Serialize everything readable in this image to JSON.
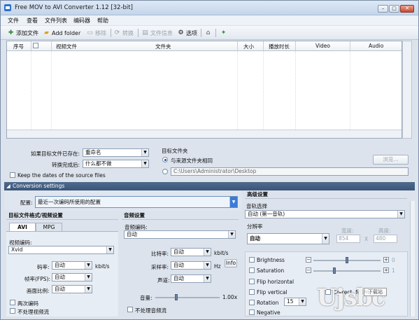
{
  "window": {
    "title": "Free MOV to AVI Converter 1.12  [32-bit]",
    "min": "–",
    "max": "□",
    "close": "✕"
  },
  "menu": [
    "文件",
    "查看",
    "文件列表",
    "编码器",
    "帮助"
  ],
  "toolbar": {
    "add_file": "添加文件",
    "add_folder": "Add folder",
    "remove": "移除",
    "convert": "转换",
    "file_info": "文件信息",
    "options": "选项"
  },
  "grid": {
    "headers": [
      "序号",
      "",
      "视频文件",
      "文件夹",
      "大小",
      "播放时长",
      "Video",
      "Audio"
    ]
  },
  "output": {
    "if_exists_label": "如果目标文件已存在:",
    "if_exists_value": "重命名",
    "after_label": "转换完成后:",
    "after_value": "什么都不做",
    "keep_dates": "Keep the dates of the source files",
    "target_folder_label": "目标文件夹",
    "same_as_source": "与来源文件夹相同",
    "path": "C:\\Users\\Administrator\\Desktop",
    "browse": "浏览..."
  },
  "settings": {
    "header": "Conversion settings",
    "profile_label": "配置:",
    "profile_value": "最近一次编码所使用的配置",
    "format_section": "目标文件格式/视频设置",
    "tabs": [
      "AVI",
      "MPG"
    ],
    "video_codec_label": "视频编码:",
    "video_codec": "Xvid",
    "bitrate_label": "码率:",
    "bitrate": "自动",
    "bitrate_unit": "kbit/s",
    "fps_label": "帧率(FPS):",
    "fps": "自动",
    "aspect_label": "画面比例:",
    "aspect": "自动",
    "two_pass": "两次编码",
    "no_video": "不处理视频流",
    "audio_section": "音频设置",
    "audio_codec_label": "音频编码:",
    "audio_codec": "自动",
    "abitrate_label": "比特率:",
    "abitrate": "自动",
    "abitrate_unit": "kbit/s",
    "sample_label": "采样率:",
    "sample": "自动",
    "sample_unit": "Hz",
    "info": "Info",
    "channels_label": "声道:",
    "channels": "自动",
    "volume_label": "音量:",
    "volume": "1.00x",
    "no_audio": "不处理音频流",
    "advanced": "高级设置",
    "track_label": "音轨选择",
    "track": "自动 (第一音轨)",
    "res_label": "分辨率",
    "res": "自动",
    "width_label": "宽度:",
    "height_label": "高度:",
    "width": "854",
    "height": "480",
    "x": "X",
    "brightness": "Brightness",
    "saturation": "Saturation",
    "flip_h": "Flip horizontal",
    "flip_v": "Flip vertical",
    "rotation": "Rotation",
    "rotation_val": "15",
    "negative": "Negative",
    "corr": "Correct. for to",
    "plus": "+",
    "minus": "−",
    "zero": "0",
    "one": "1"
  },
  "watermark": {
    "text": "Ujsbc",
    "badge": "下载站"
  }
}
